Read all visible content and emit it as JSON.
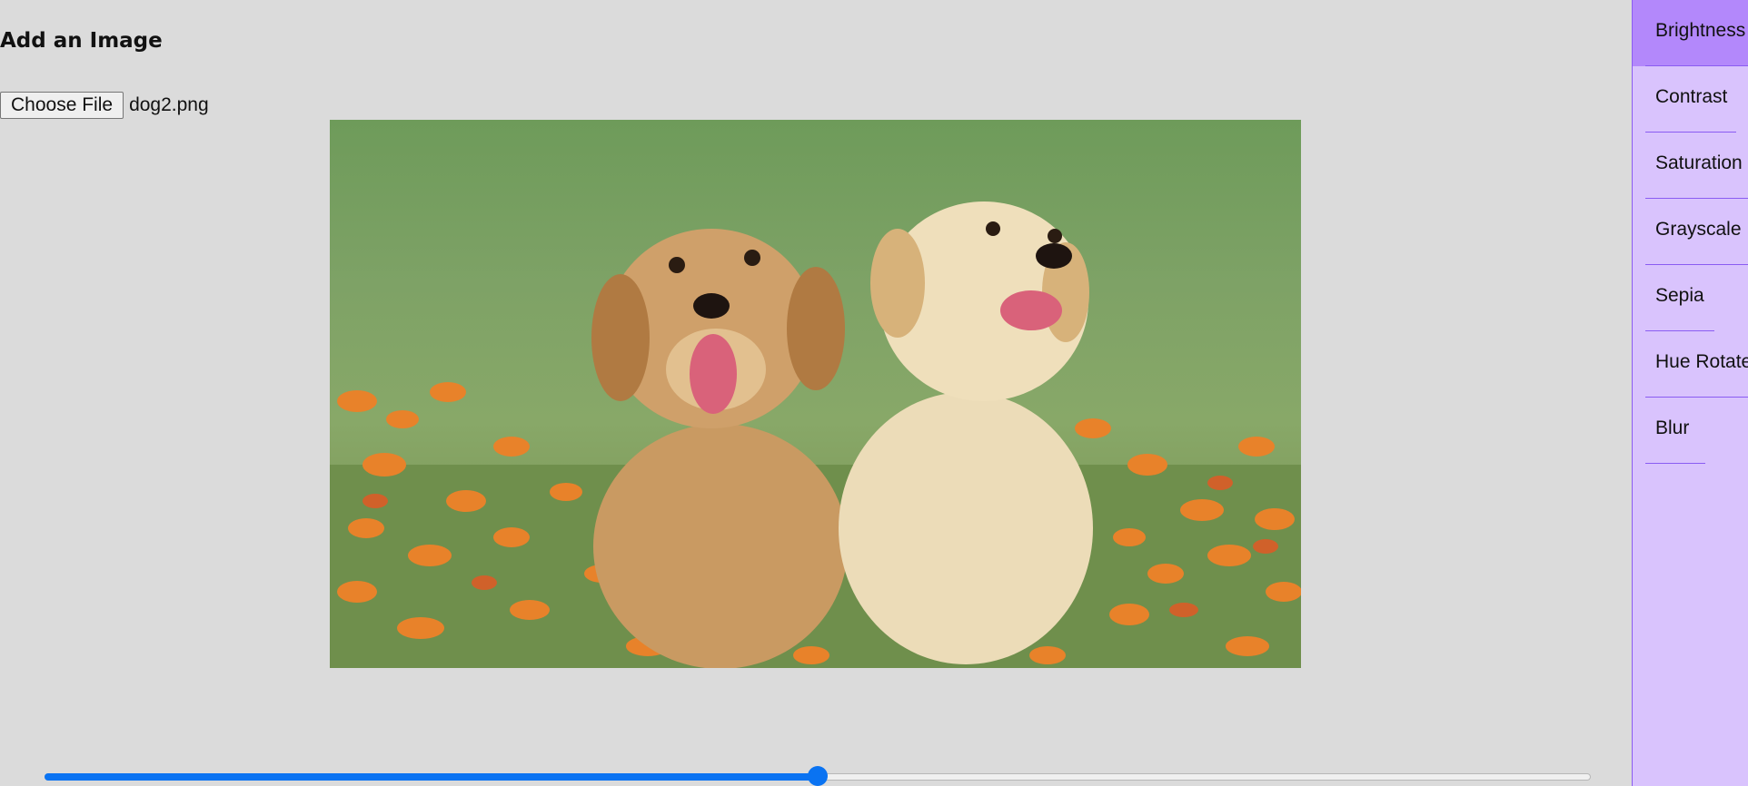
{
  "main": {
    "title": "Add an Image",
    "file_input": {
      "button_label": "Choose File",
      "file_name": "dog2.png"
    },
    "image": {
      "alt": "Two golden retriever puppies sitting in grass with orange flowers"
    },
    "slider": {
      "value_percent": 50
    }
  },
  "sidebar": {
    "active_color": "#b388fb",
    "background_color": "#d9c3fd",
    "items": [
      {
        "label": "Brightness",
        "active": true
      },
      {
        "label": "Contrast",
        "active": false
      },
      {
        "label": "Saturation",
        "active": false
      },
      {
        "label": "Grayscale",
        "active": false
      },
      {
        "label": "Sepia",
        "active": false
      },
      {
        "label": "Hue Rotate",
        "active": false
      },
      {
        "label": "Blur",
        "active": false
      }
    ]
  }
}
